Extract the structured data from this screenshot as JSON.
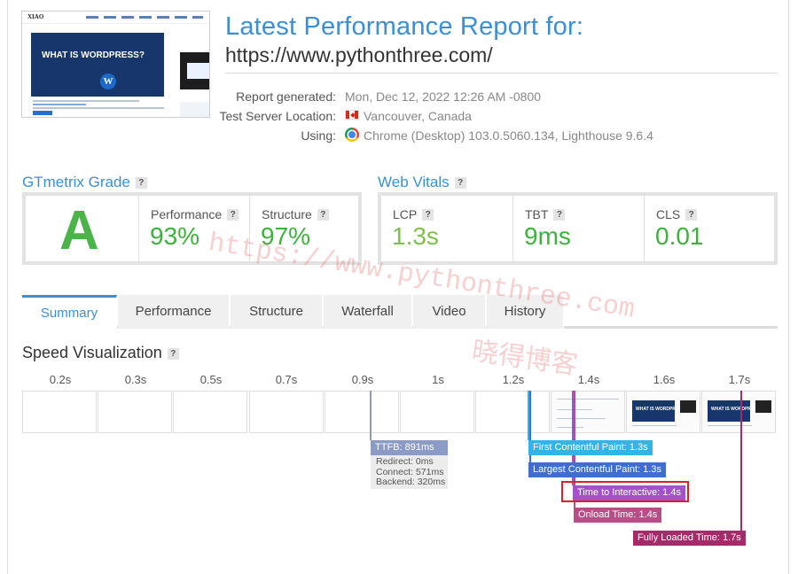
{
  "header": {
    "title_line1": "Latest Performance Report for:",
    "title_line2": "https://www.pythonthree.com/",
    "thumbnail": {
      "logo": "XIAO",
      "hero_text": "WHAT IS WORDPRESS?"
    }
  },
  "meta": {
    "generated_label": "Report generated:",
    "generated_value": "Mon, Dec 12, 2022 12:26 AM -0800",
    "location_label": "Test Server Location:",
    "location_value": "Vancouver, Canada",
    "location_icon": "canada-flag-icon",
    "using_label": "Using:",
    "using_value": "Chrome (Desktop) 103.0.5060.134, Lighthouse 9.6.4",
    "using_icon": "chrome-icon"
  },
  "grade": {
    "title": "GTmetrix Grade",
    "letter": "A",
    "performance_label": "Performance",
    "performance_value": "93%",
    "structure_label": "Structure",
    "structure_value": "97%"
  },
  "vitals": {
    "title": "Web Vitals",
    "lcp_label": "LCP",
    "lcp_value": "1.3s",
    "tbt_label": "TBT",
    "tbt_value": "9ms",
    "cls_label": "CLS",
    "cls_value": "0.01"
  },
  "tabs": [
    "Summary",
    "Performance",
    "Structure",
    "Waterfall",
    "Video",
    "History"
  ],
  "active_tab": "Summary",
  "speed": {
    "title": "Speed Visualization",
    "ticks": [
      "0.2s",
      "0.3s",
      "0.5s",
      "0.7s",
      "0.9s",
      "1s",
      "1.2s",
      "1.4s",
      "1.6s",
      "1.7s"
    ],
    "ttfb": "TTFB: 891ms",
    "ttfb_detail": [
      "Redirect: 0ms",
      "Connect: 571ms",
      "Backend: 320ms"
    ],
    "fcp": "First Contentful Paint: 1.3s",
    "lcp": "Largest Contentful Paint: 1.3s",
    "tti": "Time to Interactive: 1.4s",
    "onload": "Onload Time: 1.4s",
    "fully_loaded": "Fully Loaded Time: 1.7s",
    "frame_hero_text": "WHAT IS WORDPRESS?"
  },
  "watermark": {
    "url": "https://www.pythonthree.com",
    "cn": "晓得博客"
  },
  "colors": {
    "accent_blue": "#3a8fd6",
    "grade_green": "#4cb34a",
    "ttfb": "#8b9bc6",
    "fcp": "#35b3e6",
    "lcp": "#3e6fd0",
    "tti": "#a452c9",
    "onload": "#b74f86",
    "fully_loaded": "#a62a6a",
    "highlight": "#e02020"
  }
}
